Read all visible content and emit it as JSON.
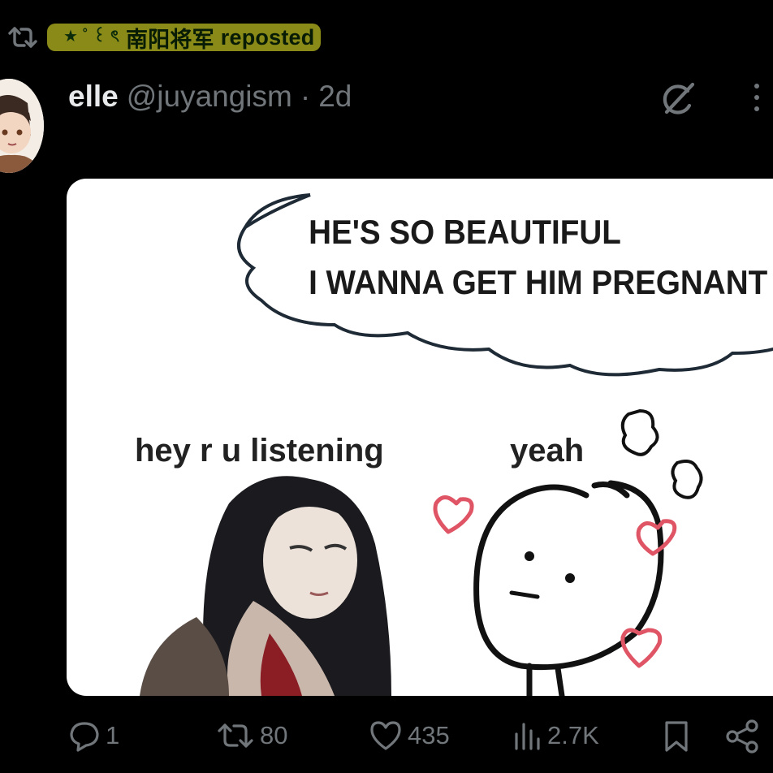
{
  "repost": {
    "decoration": "★ ˚ ꒰ ৎ",
    "reposter": "南阳将军",
    "label": "reposted",
    "highlight_color": "#8a8a18"
  },
  "tweet": {
    "author_name": "elle",
    "author_handle": "@juyangism",
    "separator": "·",
    "timestamp": "2d"
  },
  "meme": {
    "thought_line1": "HE'S SO BEAUTIFUL",
    "thought_line2": "I WANNA GET HIM PREGNANT",
    "left_caption": "hey r u listening",
    "right_caption": "yeah"
  },
  "actions": {
    "replies": "1",
    "reposts": "80",
    "likes": "435",
    "views": "2.7K"
  },
  "icons": [
    "retweet-icon",
    "grok-icon",
    "more-icon",
    "reply-icon",
    "repost-icon",
    "like-icon",
    "views-icon",
    "bookmark-icon",
    "share-icon"
  ],
  "colors": {
    "background": "#000000",
    "text": "#e7e9ea",
    "muted": "#71767b",
    "heart": "#e05565"
  }
}
